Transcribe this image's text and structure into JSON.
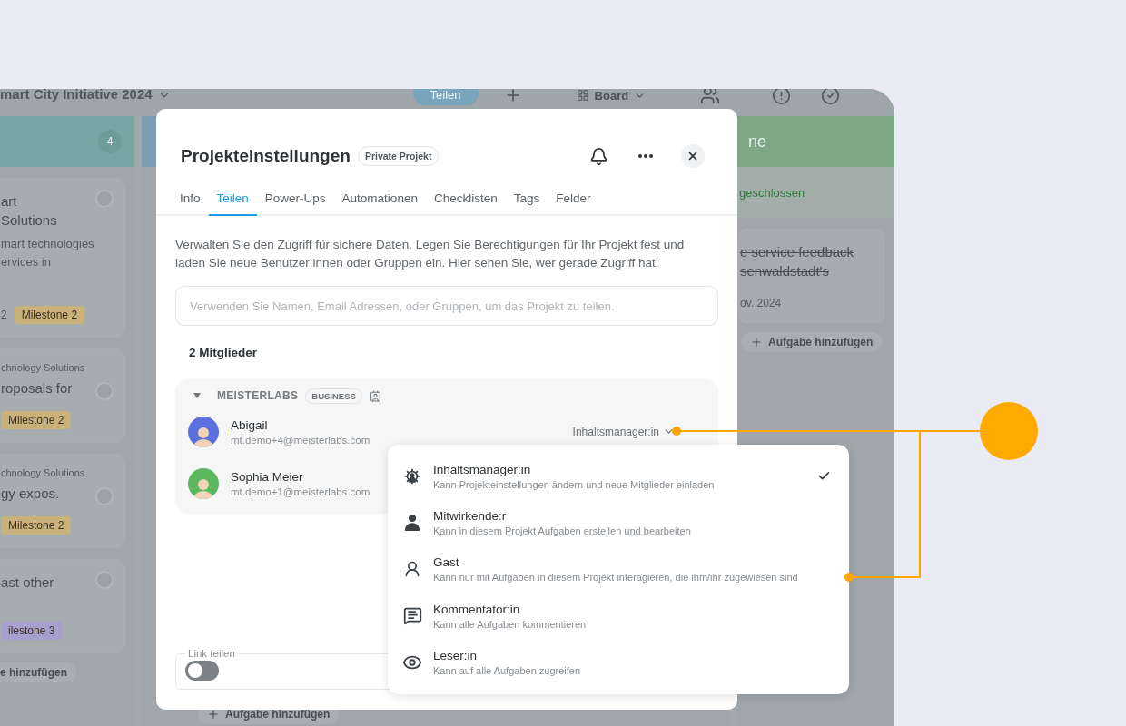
{
  "app": {
    "project_title": "mart City Initiative 2024",
    "share_button": "Teilen",
    "view_switch": "Board",
    "columns": [
      {
        "color": "#78a6a6",
        "count": "4",
        "cards": [
          {
            "title_lines": [
              "art",
              "Solutions"
            ],
            "description_lines": [
              "mart technologies",
              "ervices in"
            ],
            "comment_count": "2",
            "tag": {
              "label": "Milestone 2",
              "color": "#c9b27a"
            }
          },
          {
            "category": "chnology Solutions",
            "title_lines": [
              "roposals for"
            ],
            "tag": {
              "label": "Milestone 2",
              "color": "#c9b27a"
            }
          },
          {
            "category": "chnology Solutions",
            "title_lines": [
              "gy expos."
            ],
            "tag": {
              "label": "Milestone 2",
              "color": "#c9b27a"
            }
          },
          {
            "title_lines": [
              "ast other"
            ],
            "tag": {
              "label": "ilestone 3",
              "color": "#a79fd0"
            }
          }
        ],
        "add_button": "e hinzufügen"
      },
      {
        "color": "#7b9cb2",
        "add_button": "Aufgabe hinzufügen"
      },
      {
        "color": "#7da684",
        "title": "ne",
        "subtitle": "geschlossen",
        "cards": [
          {
            "title_lines": [
              "e service feedback",
              "senwaldstadt's"
            ],
            "done": true,
            "date": "ov. 2024"
          }
        ],
        "add_button": "Aufgabe hinzufügen"
      }
    ]
  },
  "dialog": {
    "title": "Projekteinstellungen",
    "badge": "Private Projekt",
    "tabs": [
      {
        "label": "Info",
        "selected": false
      },
      {
        "label": "Teilen",
        "selected": true
      },
      {
        "label": "Power-Ups",
        "selected": false
      },
      {
        "label": "Automationen",
        "selected": false
      },
      {
        "label": "Checklisten",
        "selected": false
      },
      {
        "label": "Tags",
        "selected": false
      },
      {
        "label": "Felder",
        "selected": false
      }
    ],
    "description": "Verwalten Sie den Zugriff für sichere Daten. Legen Sie Berechtigungen für Ihr Projekt fest und laden Sie neue Benutzer:innen oder Gruppen ein. Hier sehen Sie, wer gerade Zugriff hat:",
    "invite_field": {
      "placeholder": "Verwenden Sie Namen, Email Adressen, oder Gruppen, um das Projekt zu teilen."
    },
    "member_count": "2 Mitglieder",
    "group": {
      "name": "MEISTERLABS",
      "plan": "BUSINESS",
      "expanded": true,
      "members": [
        {
          "name": "Abigail",
          "email": "mt.demo+4@meisterlabs.com",
          "color": "#5a6fe0",
          "role": "Inhaltsmanager:in"
        },
        {
          "name": "Sophia Meier",
          "email": "mt.demo+1@meisterlabs.com",
          "color": "#5cb85c"
        }
      ]
    },
    "link_share": {
      "label": "Link teilen",
      "on": false
    }
  },
  "role_menu": [
    {
      "title": "Inhaltsmanager:in",
      "description": "Kann Projekteinstellungen ändern und neue Mitglieder einladen",
      "selected": true
    },
    {
      "title": "Mitwirkende:r",
      "description": "Kann in diesem Projekt Aufgaben erstellen und bearbeiten",
      "selected": false
    },
    {
      "title": "Gast",
      "description": "Kann nur mit Aufgaben in diesem Projekt interagieren, die ihm/ihr zugewiesen sind",
      "selected": false
    },
    {
      "title": "Kommentator:in",
      "description": "Kann alle Aufgaben kommentieren",
      "selected": false
    },
    {
      "title": "Leser:in",
      "description": "Kann auf alle Aufgaben zugreifen",
      "selected": false
    }
  ]
}
